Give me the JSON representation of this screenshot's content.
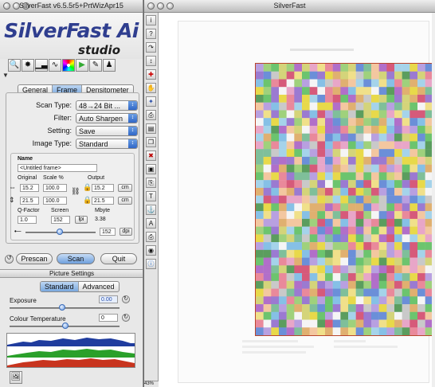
{
  "left_window": {
    "title": "SilverFast v6.5.5r5+PrtWizApr15",
    "logo_main": "SilverFast Ai",
    "logo_sub": "studio",
    "tabs": [
      "General",
      "Frame",
      "Densitometer"
    ],
    "selected_tab": "Frame",
    "fields": {
      "scan_type": {
        "label": "Scan Type:",
        "value": "48→24 Bit ..."
      },
      "filter": {
        "label": "Filter:",
        "value": "Auto Sharpen"
      },
      "setting": {
        "label": "Setting:",
        "value": "Save"
      },
      "image_type": {
        "label": "Image Type:",
        "value": "Standard"
      }
    },
    "frame": {
      "name_label": "Name",
      "name_value": "<Untitled frame>",
      "original_label": "Original",
      "scale_label": "Scale %",
      "output_label": "Output",
      "original_w": "15.2",
      "original_h": "21.5",
      "scale_w": "100.0",
      "scale_h": "100.0",
      "output_w": "15.2",
      "output_h": "21.5",
      "unit": "cm",
      "qfactor_label": "Q-Factor",
      "screen_label": "Screen",
      "mbyte_label": "Mbyte",
      "qfactor_value": "1.0",
      "screen_value": "152",
      "screen_unit": "lpi",
      "mbyte_value": "3.38",
      "resolution_value": "152",
      "resolution_unit": "dpi"
    },
    "buttons": {
      "prescan": "Prescan",
      "scan": "Scan",
      "quit": "Quit"
    },
    "picture_settings": {
      "title": "Picture Settings",
      "tabs": [
        "Standard",
        "Advanced"
      ],
      "selected_tab": "Standard",
      "exposure_label": "Exposure",
      "exposure_value": "0.00",
      "colour_temp_label": "Colour Temperature",
      "colour_temp_value": "0"
    },
    "icons": [
      "magnifier-icon",
      "aperture-icon",
      "histogram-icon",
      "curves-icon",
      "color-wheel-icon",
      "color-triangle-icon",
      "pen-icon",
      "figure-icon"
    ]
  },
  "right_window": {
    "title": "SilverFast",
    "zoom": "43%",
    "toolbar_icons": [
      "info-icon",
      "help-icon",
      "rotate-icon",
      "mirror-icon",
      "crosshair-icon",
      "hand-icon",
      "auto-adjust-icon",
      "print-icon",
      "scan-icon",
      "copy-icon",
      "trash-icon",
      "frame-icon",
      "paste-icon",
      "text-icon",
      "stamp-icon",
      "print-settings-icon",
      "printer-icon",
      "zoom-icon",
      "info-blue-icon"
    ],
    "colors": {
      "grid_border": "#b9462d",
      "selected_tab": "#7aa8de"
    }
  }
}
